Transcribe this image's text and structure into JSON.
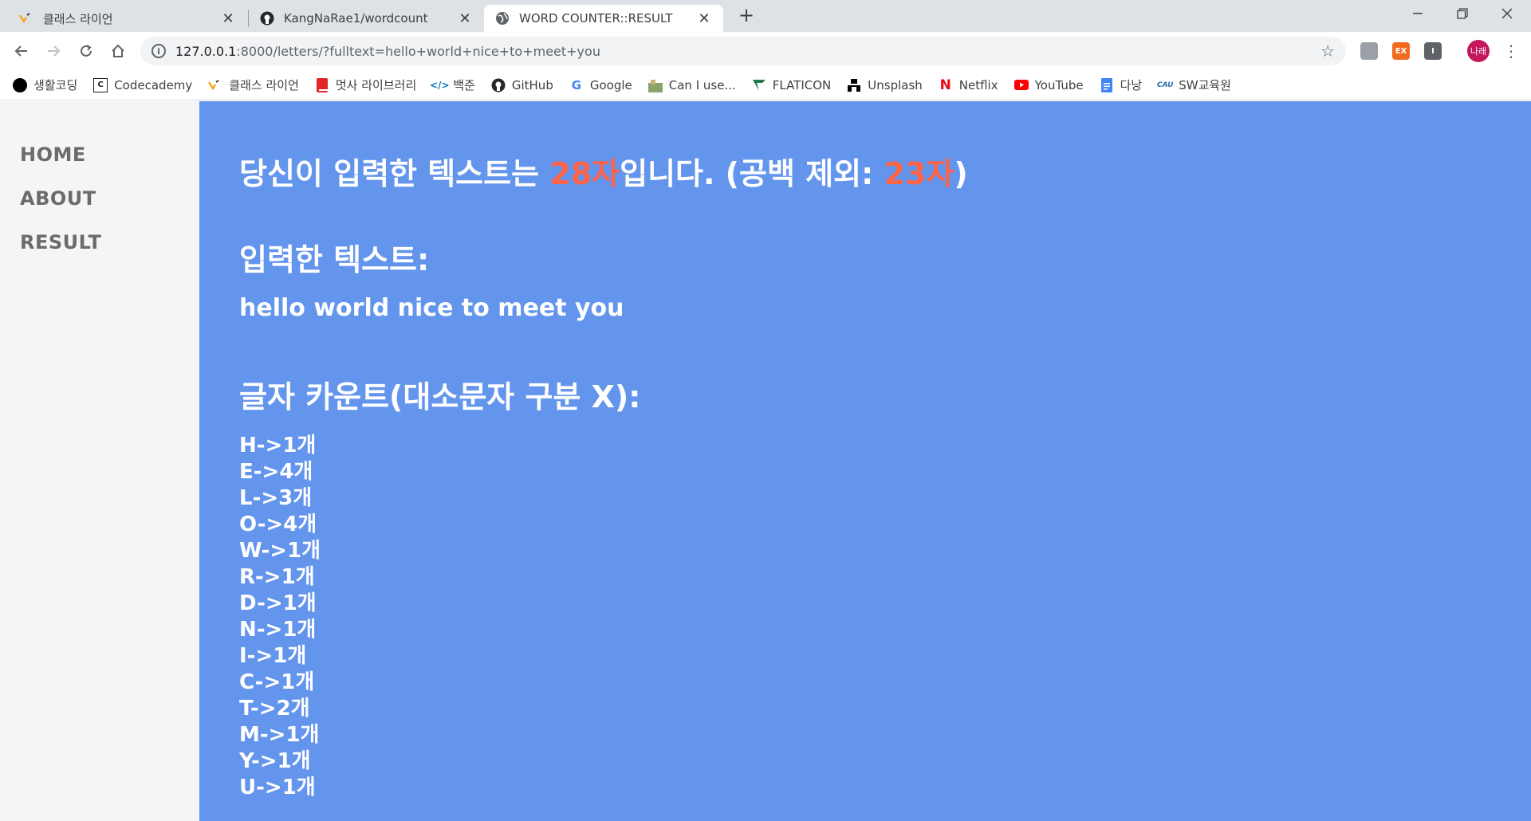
{
  "browser": {
    "tabs": [
      {
        "title": "클래스 라이언",
        "icon": "classlion-icon"
      },
      {
        "title": "KangNaRae1/wordcount",
        "icon": "github-icon"
      },
      {
        "title": "WORD COUNTER::RESULT",
        "icon": "globe-icon",
        "active": true
      }
    ],
    "new_tab": "+",
    "url_host": "127.0.0.1",
    "url_rest": ":8000/letters/?fulltext=hello+world+nice+to+meet+you",
    "profile_initials": "나래",
    "extensions": [
      {
        "label": "",
        "color": "#9aa0a6"
      },
      {
        "label": "EX",
        "color": "#f26b21"
      },
      {
        "label": "I",
        "color": "#5f6368"
      }
    ],
    "bookmarks": [
      {
        "label": "생활코딩",
        "icon": "circle-icon",
        "color": "#000000"
      },
      {
        "label": "Codecademy",
        "icon": "codecademy-icon",
        "color": "#1f1f1f"
      },
      {
        "label": "클래스 라이언",
        "icon": "classlion-icon",
        "color": "#f6a623"
      },
      {
        "label": "멋사 라이브러리",
        "icon": "book-icon",
        "color": "#e3262a"
      },
      {
        "label": "백준",
        "icon": "code-icon",
        "color": "#0076c0"
      },
      {
        "label": "GitHub",
        "icon": "github-icon",
        "color": "#000000"
      },
      {
        "label": "Google",
        "icon": "google-icon",
        "color": "#4285f4"
      },
      {
        "label": "Can I use...",
        "icon": "caniuse-icon",
        "color": "#6a8c4a"
      },
      {
        "label": "FLATICON",
        "icon": "flaticon-icon",
        "color": "#1f7a4d"
      },
      {
        "label": "Unsplash",
        "icon": "unsplash-icon",
        "color": "#000000"
      },
      {
        "label": "Netflix",
        "icon": "netflix-icon",
        "color": "#e50914"
      },
      {
        "label": "YouTube",
        "icon": "youtube-icon",
        "color": "#ff0000"
      },
      {
        "label": "다낭",
        "icon": "doc-icon",
        "color": "#4285f4"
      },
      {
        "label": "SW교육원",
        "icon": "swedu-icon",
        "color": "#2a6fb0"
      }
    ]
  },
  "nav": {
    "home": "HOME",
    "about": "ABOUT",
    "result": "RESULT"
  },
  "result": {
    "headline_prefix": "당신이 입력한 텍스트는 ",
    "total_count": "28자",
    "headline_mid": "입니다. (공백 제외: ",
    "nospace_count": "23자",
    "headline_suffix": ")",
    "input_label": "입력한 텍스트:",
    "input_text": "hello world nice to meet you",
    "count_label": "글자 카운트(대소문자 구분 X):",
    "letter_counts": [
      "H->1개",
      "E->4개",
      "L->3개",
      "O->4개",
      "W->1개",
      "R->1개",
      "D->1개",
      "N->1개",
      "I->1개",
      "C->1개",
      "T->2개",
      "M->1개",
      "Y->1개",
      "U->1개"
    ]
  }
}
